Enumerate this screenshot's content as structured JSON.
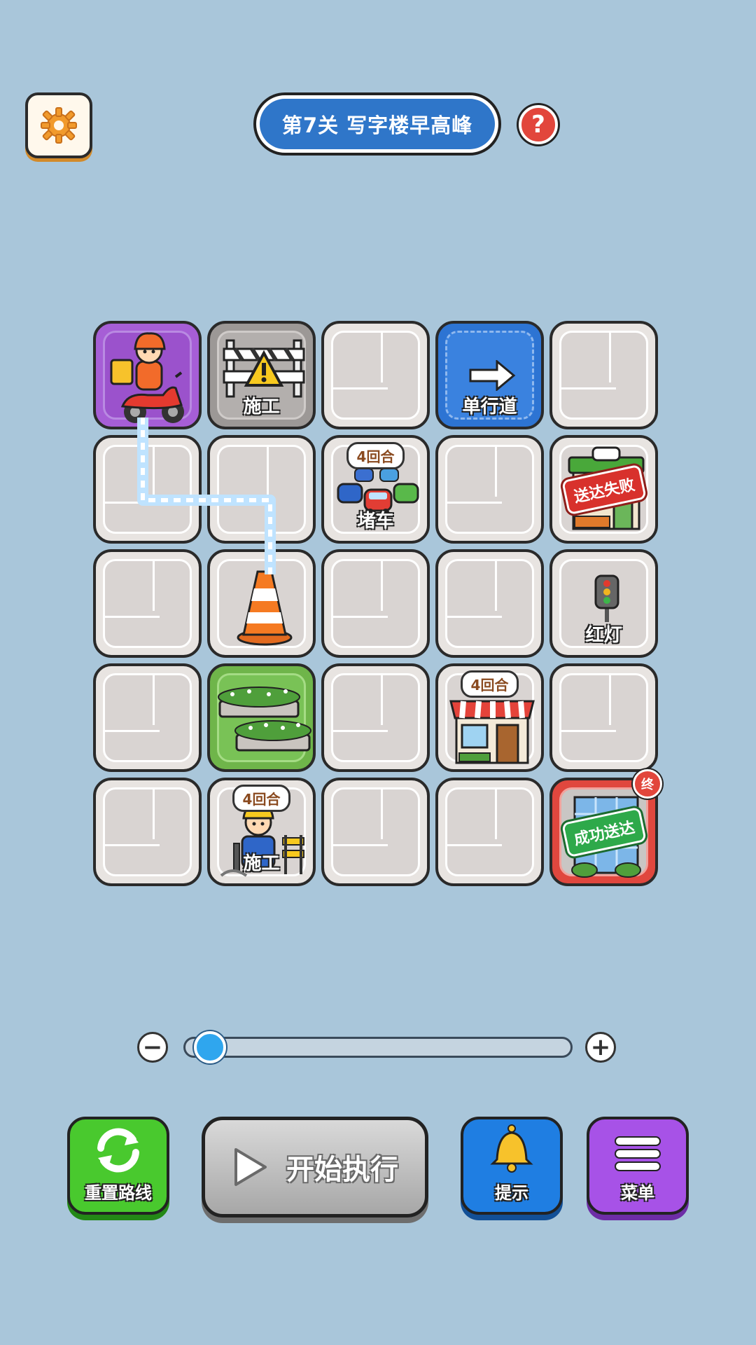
{
  "header": {
    "settings_icon": "gear-icon",
    "level_title": "第7关  写字楼早高峰",
    "help_symbol": "?"
  },
  "grid": {
    "rows": 5,
    "cols": 5,
    "tiles": {
      "start": {
        "row": 1,
        "col": 1,
        "icon": "courier-scooter-icon"
      },
      "construction_barrier": {
        "row": 1,
        "col": 2,
        "label": "施工",
        "icon": "warning-barrier-icon"
      },
      "one_way": {
        "row": 1,
        "col": 4,
        "label": "单行道",
        "icon": "arrow-right-icon"
      },
      "traffic_jam": {
        "row": 2,
        "col": 3,
        "label": "堵车",
        "badge": "4回合",
        "icon": "cars-icon"
      },
      "delivery_fail": {
        "row": 2,
        "col": 5,
        "stamp": "送达失败",
        "icon": "shop-icon"
      },
      "traffic_cone": {
        "row": 3,
        "col": 2,
        "icon": "traffic-cone-icon"
      },
      "red_light": {
        "row": 3,
        "col": 5,
        "label": "红灯",
        "icon": "traffic-light-icon"
      },
      "planter": {
        "row": 4,
        "col": 2,
        "icon": "flower-bed-icon"
      },
      "store": {
        "row": 4,
        "col": 4,
        "badge": "4回合",
        "icon": "storefront-icon"
      },
      "road_work": {
        "row": 5,
        "col": 2,
        "label": "施工",
        "badge": "4回合",
        "icon": "worker-icon"
      },
      "delivery_success": {
        "row": 5,
        "col": 5,
        "stamp": "成功送达",
        "pin": "终",
        "icon": "office-building-icon"
      }
    },
    "path_icon": "route-path-line"
  },
  "speed_slider": {
    "minus_symbol": "−",
    "plus_symbol": "+",
    "value_fraction": 0.03
  },
  "buttons": {
    "reset": {
      "label": "重置路线",
      "icon": "refresh-icon"
    },
    "start": {
      "label": "开始执行",
      "icon": "play-icon"
    },
    "hint": {
      "label": "提示",
      "icon": "bell-icon"
    },
    "menu": {
      "label": "菜单",
      "icon": "hamburger-icon"
    }
  },
  "colors": {
    "background": "#a9c6da",
    "title_blue": "#2f76c9",
    "start_tile": "#a65ed6",
    "one_way_tile": "#2d74d3",
    "planter_tile": "#6fb54a",
    "goal_tile": "#e0473e",
    "reset_green": "#49c92e",
    "hint_blue": "#1f7ee2",
    "menu_purple": "#a752e7"
  }
}
